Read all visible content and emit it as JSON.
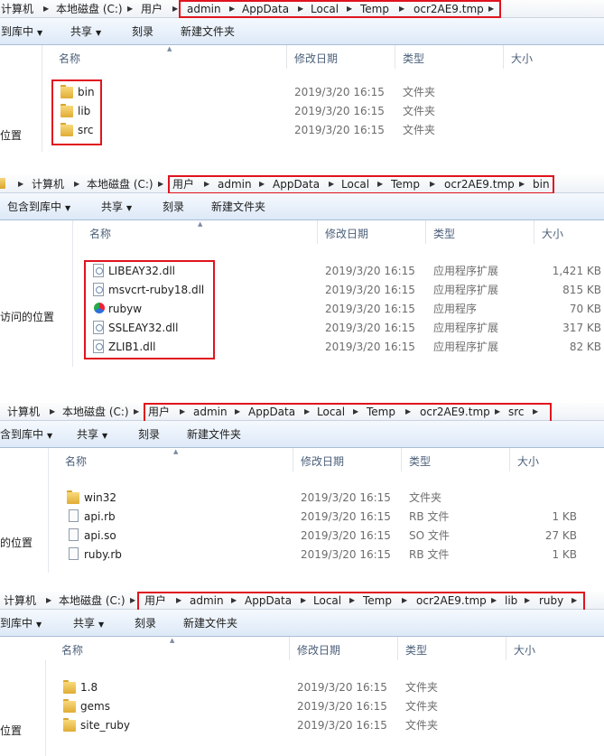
{
  "panels": [
    {
      "address": [
        "计算机",
        "本地磁盘 (C:)",
        "用户",
        "admin",
        "AppData",
        "Local",
        "Temp",
        "ocr2AE9.tmp"
      ],
      "toolbar": [
        "到库中",
        "共享",
        "刻录",
        "新建文件夹"
      ],
      "sidebar_label": "位置",
      "headers": [
        "名称",
        "修改日期",
        "类型",
        "大小"
      ],
      "rows": [
        {
          "icon": "folder-icon",
          "name": "bin",
          "date": "2019/3/20 16:15",
          "type": "文件夹",
          "size": ""
        },
        {
          "icon": "folder-icon",
          "name": "lib",
          "date": "2019/3/20 16:15",
          "type": "文件夹",
          "size": ""
        },
        {
          "icon": "folder-icon",
          "name": "src",
          "date": "2019/3/20 16:15",
          "type": "文件夹",
          "size": ""
        }
      ]
    },
    {
      "address": [
        "计算机",
        "本地磁盘 (C:)",
        "用户",
        "admin",
        "AppData",
        "Local",
        "Temp",
        "ocr2AE9.tmp",
        "bin"
      ],
      "toolbar": [
        "包含到库中",
        "共享",
        "刻录",
        "新建文件夹"
      ],
      "sidebar_label": "访问的位置",
      "headers": [
        "名称",
        "修改日期",
        "类型",
        "大小"
      ],
      "rows": [
        {
          "icon": "dll-icon",
          "name": "LIBEAY32.dll",
          "date": "2019/3/20 16:15",
          "type": "应用程序扩展",
          "size": "1,421 KB"
        },
        {
          "icon": "dll-icon",
          "name": "msvcrt-ruby18.dll",
          "date": "2019/3/20 16:15",
          "type": "应用程序扩展",
          "size": "815 KB"
        },
        {
          "icon": "ruby-icon",
          "name": "rubyw",
          "date": "2019/3/20 16:15",
          "type": "应用程序",
          "size": "70 KB"
        },
        {
          "icon": "dll-icon",
          "name": "SSLEAY32.dll",
          "date": "2019/3/20 16:15",
          "type": "应用程序扩展",
          "size": "317 KB"
        },
        {
          "icon": "dll-icon",
          "name": "ZLIB1.dll",
          "date": "2019/3/20 16:15",
          "type": "应用程序扩展",
          "size": "82 KB"
        }
      ]
    },
    {
      "address": [
        "计算机",
        "本地磁盘 (C:)",
        "用户",
        "admin",
        "AppData",
        "Local",
        "Temp",
        "ocr2AE9.tmp",
        "src"
      ],
      "toolbar": [
        "含到库中",
        "共享",
        "刻录",
        "新建文件夹"
      ],
      "sidebar_label": "的位置",
      "headers": [
        "名称",
        "修改日期",
        "类型",
        "大小"
      ],
      "rows": [
        {
          "icon": "folder-icon",
          "name": "win32",
          "date": "2019/3/20 16:15",
          "type": "文件夹",
          "size": ""
        },
        {
          "icon": "file-icon",
          "name": "api.rb",
          "date": "2019/3/20 16:15",
          "type": "RB 文件",
          "size": "1 KB"
        },
        {
          "icon": "file-icon",
          "name": "api.so",
          "date": "2019/3/20 16:15",
          "type": "SO 文件",
          "size": "27 KB"
        },
        {
          "icon": "file-icon",
          "name": "ruby.rb",
          "date": "2019/3/20 16:15",
          "type": "RB 文件",
          "size": "1 KB"
        }
      ]
    },
    {
      "address": [
        "计算机",
        "本地磁盘 (C:)",
        "用户",
        "admin",
        "AppData",
        "Local",
        "Temp",
        "ocr2AE9.tmp",
        "lib",
        "ruby"
      ],
      "toolbar": [
        "到库中",
        "共享",
        "刻录",
        "新建文件夹"
      ],
      "sidebar_label": "位置",
      "headers": [
        "名称",
        "修改日期",
        "类型",
        "大小"
      ],
      "rows": [
        {
          "icon": "folder-icon",
          "name": "1.8",
          "date": "2019/3/20 16:15",
          "type": "文件夹",
          "size": ""
        },
        {
          "icon": "folder-icon",
          "name": "gems",
          "date": "2019/3/20 16:15",
          "type": "文件夹",
          "size": ""
        },
        {
          "icon": "folder-icon",
          "name": "site_ruby",
          "date": "2019/3/20 16:15",
          "type": "文件夹",
          "size": ""
        }
      ]
    }
  ]
}
